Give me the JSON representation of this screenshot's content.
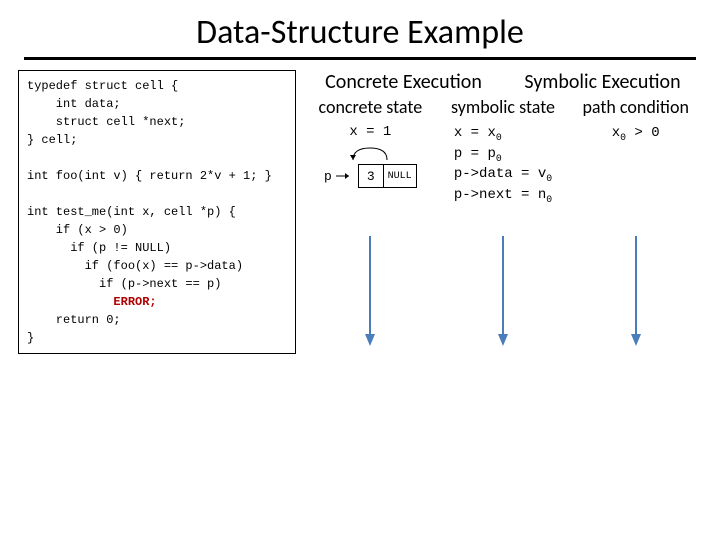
{
  "title": "Data-Structure Example",
  "code": {
    "l1": "typedef struct cell {",
    "l2": "    int data;",
    "l3": "    struct cell *next;",
    "l4": "} cell;",
    "l5": "",
    "l6": "int foo(int v) { return 2*v + 1; }",
    "l7": "",
    "l8": "int test_me(int x, cell *p) {",
    "l9": "    if (x > 0)",
    "l10": "      if (p != NULL)",
    "l11": "        if (foo(x) == p->data)",
    "l12": "          if (p->next == p)",
    "l13_err": "            ERROR;",
    "l14": "    return 0;",
    "l15": "}"
  },
  "headers": {
    "concrete": "Concrete Execution",
    "symbolic": "Symbolic Execution"
  },
  "subheaders": {
    "concrete_state": "concrete state",
    "symbolic_state": "symbolic state",
    "path_condition": "path condition"
  },
  "concrete": {
    "assign": "x = 1",
    "ptr_label": "p",
    "cell_data": "3",
    "cell_next": "NULL"
  },
  "symbolic": {
    "line1_pre": "x = x",
    "line1_sub": "0",
    "line2_pre": "p = p",
    "line2_sub": "0",
    "line3_pre": "p->data = v",
    "line3_sub": "0",
    "line4_pre": "p->next = n",
    "line4_sub": "0"
  },
  "path": {
    "pre": "x",
    "sub": "0",
    "rest": " > 0"
  }
}
